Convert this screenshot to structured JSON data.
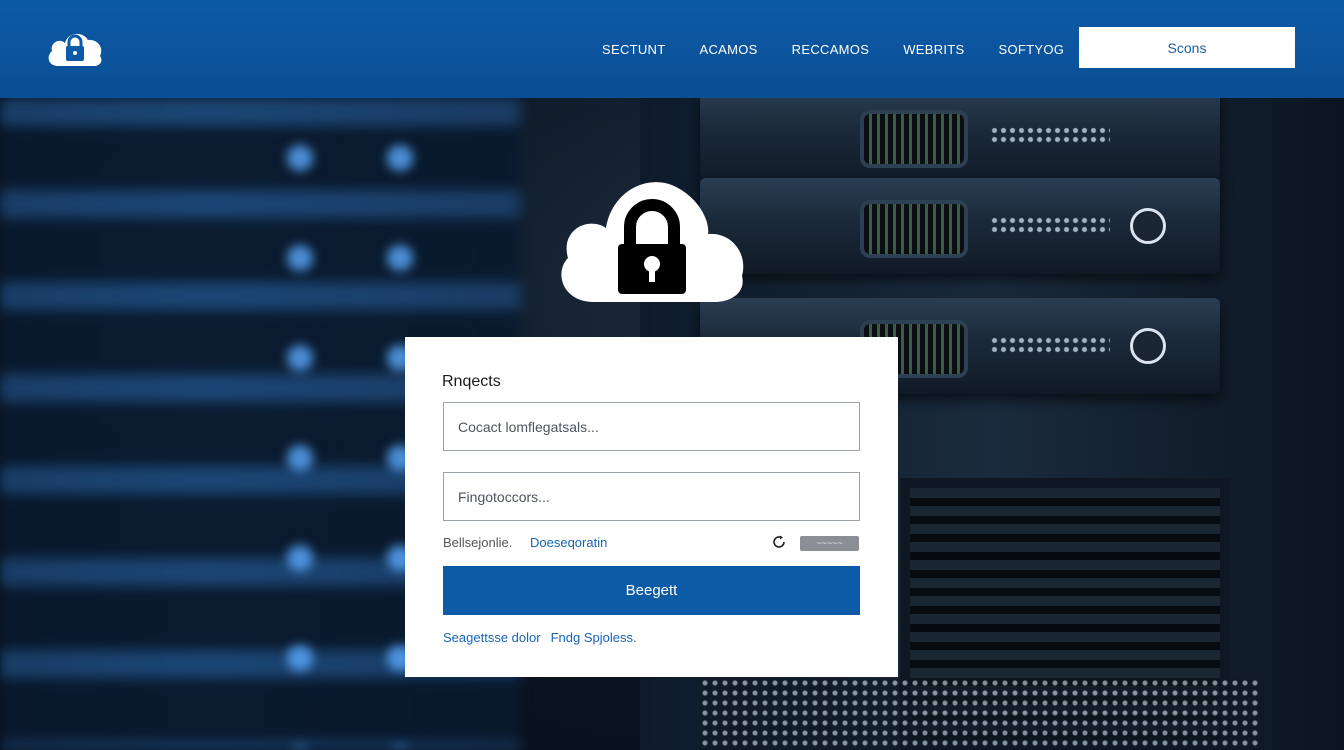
{
  "header": {
    "nav": [
      "SECTUNT",
      "ACAMOS",
      "RECCAMOS",
      "WEBRITS",
      "SOFTYOG"
    ],
    "search_label": "Scons"
  },
  "login": {
    "title": "Rnqects",
    "username_placeholder": "Cocact lomflegatsals...",
    "password_placeholder": "Fingotoccors...",
    "remember_label": "Bellsejonlie.",
    "forgot_label": "Doeseqoratin",
    "toggle_label": "~~~~~",
    "submit_label": "Beegett",
    "footer_left": "Seagettsse dolor",
    "footer_right": "Fndg Spjoless."
  },
  "colors": {
    "header_bg": "#0d5aa6",
    "accent": "#1565b8",
    "card_bg": "#ffffff"
  },
  "icons": {
    "logo": "cloud-lock-icon",
    "hero": "cloud-lock-icon",
    "refresh": "refresh-icon"
  }
}
